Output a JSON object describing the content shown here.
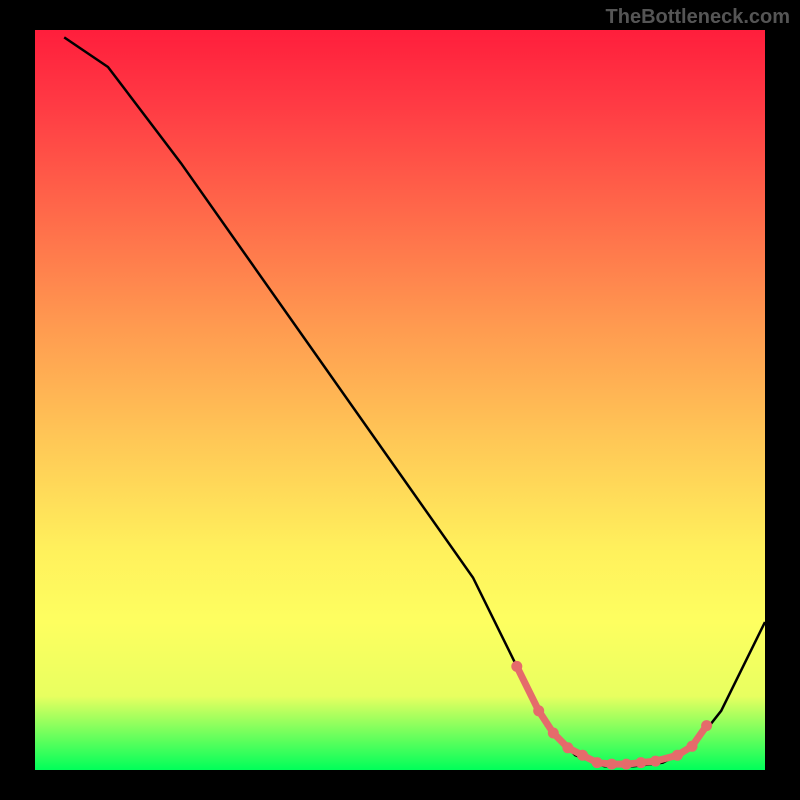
{
  "watermark": "TheBottleneck.com",
  "chart_data": {
    "type": "line",
    "title": "",
    "xlabel": "",
    "ylabel": "",
    "xlim": [
      0,
      100
    ],
    "ylim": [
      0,
      100
    ],
    "series": [
      {
        "name": "curve",
        "x": [
          4,
          10,
          20,
          30,
          40,
          50,
          60,
          66,
          70,
          74,
          78,
          82,
          86,
          90,
          94,
          100
        ],
        "y": [
          99,
          95,
          82,
          68,
          54,
          40,
          26,
          14,
          6,
          2,
          0.5,
          0.5,
          1,
          3,
          8,
          20
        ],
        "color": "#000000"
      }
    ],
    "markers": {
      "name": "highlight-dots",
      "x": [
        66,
        69,
        71,
        73,
        75,
        77,
        79,
        81,
        83,
        85,
        88,
        90,
        92
      ],
      "y": [
        14,
        8,
        5,
        3,
        2,
        1,
        0.8,
        0.8,
        1,
        1.2,
        2,
        3.2,
        6
      ],
      "color": "#e56b6b"
    },
    "gradient_stops": [
      {
        "pos": 0,
        "color": "#ff1e3c"
      },
      {
        "pos": 10,
        "color": "#ff3a44"
      },
      {
        "pos": 25,
        "color": "#ff6a4a"
      },
      {
        "pos": 40,
        "color": "#ff9a50"
      },
      {
        "pos": 55,
        "color": "#ffc656"
      },
      {
        "pos": 70,
        "color": "#fff05c"
      },
      {
        "pos": 80,
        "color": "#feff60"
      },
      {
        "pos": 90,
        "color": "#e8ff60"
      },
      {
        "pos": 100,
        "color": "#00ff5a"
      }
    ]
  }
}
